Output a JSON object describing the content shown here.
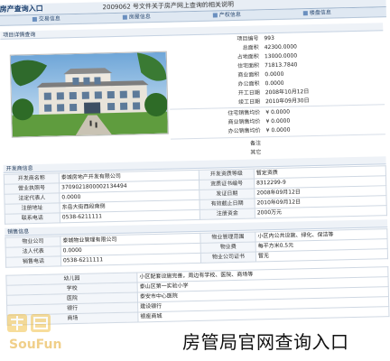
{
  "header": {
    "logo": "房产查询入口",
    "title": "2009062 号文件关于房产网上查询的相关说明"
  },
  "tabs": [
    "交易信息",
    "房屋信息",
    "产权信息",
    "楼盘信息"
  ],
  "sections": {
    "project": "项目详情查询",
    "developer": "开发商信息",
    "sales": "销售信息"
  },
  "project": {
    "rows": [
      {
        "k": "项目编号",
        "v": "993"
      },
      {
        "k": "总面积",
        "v": "42300.0000"
      },
      {
        "k": "占地面积",
        "v": "13000.0000"
      },
      {
        "k": "住宅面积",
        "v": "71813.7840"
      },
      {
        "k": "商业面积",
        "v": "0.0000"
      },
      {
        "k": "办公面积",
        "v": "0.0000"
      },
      {
        "k": "开工日期",
        "v": "2008年10月12日"
      },
      {
        "k": "竣工日期",
        "v": "2010年09月30日"
      },
      {
        "k": "住宅销售均价",
        "v": "¥ 0.0000"
      },
      {
        "k": "商业销售均价",
        "v": "¥ 0.0000"
      },
      {
        "k": "办公销售均价",
        "v": "¥ 0.0000"
      },
      {
        "k": "备注",
        "v": ""
      },
      {
        "k": "其它",
        "v": ""
      }
    ]
  },
  "developer": {
    "rows": [
      [
        "开发商名称",
        "泰城房地产开发有限公司",
        "开发资质等级",
        "暂定资质"
      ],
      [
        "营业执照号",
        "3709021800002134494",
        "资质证书编号",
        "8312299-9"
      ],
      [
        "法定代表人",
        "0.0000",
        "发证日期",
        "2008年09月12日"
      ],
      [
        "注册地址",
        "东岳大街西段南侧",
        "有效截止日期",
        "2010年09月12日"
      ],
      [
        "联系电话",
        "0538-6211111",
        "注册资金",
        "2000万元"
      ]
    ]
  },
  "sales": {
    "rows": [
      [
        "物业公司",
        "泰城物业管理有限公司",
        "物业管理范围",
        "小区内公共设施、绿化、保洁等"
      ],
      [
        "法人代表",
        "0.0000",
        "物业费",
        "每平方米0.5元"
      ],
      [
        "销售电话",
        "0538-6211111",
        "物业公司证书",
        "暂无"
      ]
    ]
  },
  "bottom": {
    "rows": [
      [
        "幼儿园",
        "小区配套设施完善，周边有学校、医院、商场等"
      ],
      [
        "学校",
        "泰山区第一实验小学"
      ],
      [
        "医院",
        "泰安市中心医院"
      ],
      [
        "银行",
        "建设银行"
      ],
      [
        "商场",
        "银座商城"
      ]
    ]
  },
  "watermark": "SouFun",
  "caption": "房管局官网查询入口"
}
